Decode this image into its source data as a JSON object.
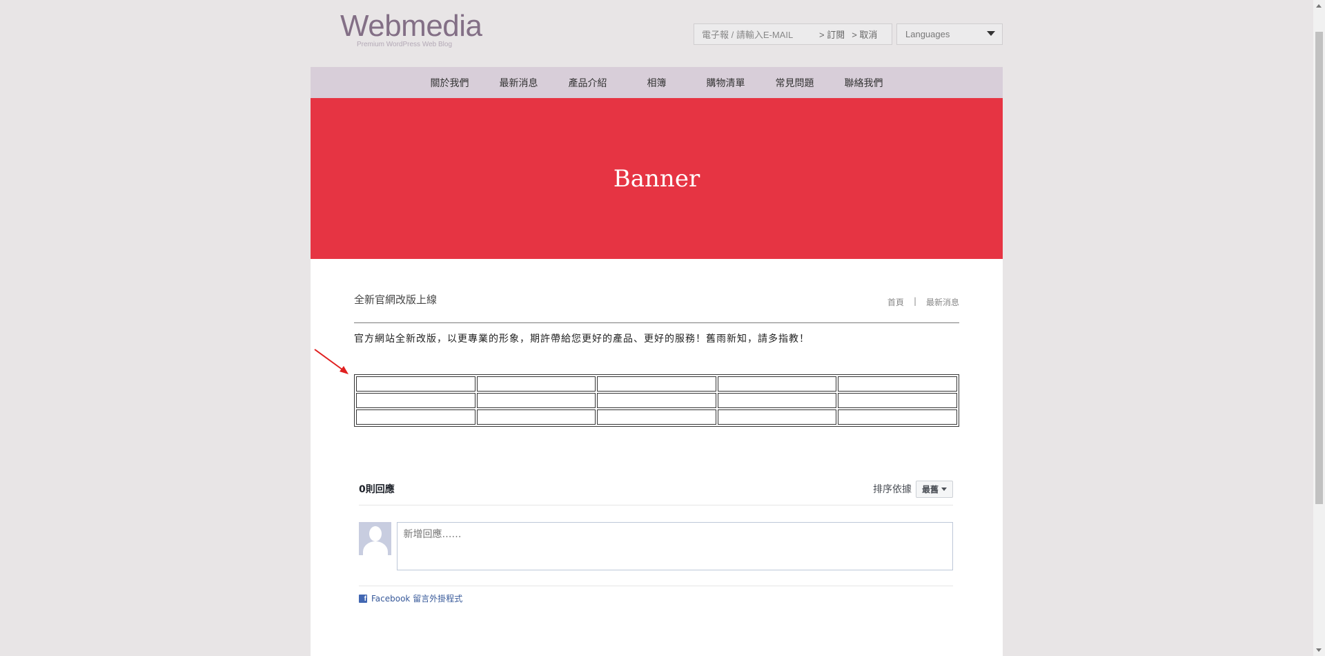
{
  "header": {
    "logo_title": "Webmedia",
    "logo_subtitle": "Premium WordPress Web Blog",
    "newsletter_placeholder": "電子報 / 請輸入E-MAIL",
    "subscribe_label": "> 訂閱",
    "cancel_label": "> 取消",
    "language_label": "Languages"
  },
  "nav": [
    {
      "label": "關於我們"
    },
    {
      "label": "最新消息"
    },
    {
      "label": "產品介紹"
    },
    {
      "label": "相簿"
    },
    {
      "label": "購物清單"
    },
    {
      "label": "常見問題"
    },
    {
      "label": "聯絡我們"
    }
  ],
  "banner": {
    "text": "Banner"
  },
  "post": {
    "title": "全新官網改版上線",
    "breadcrumb": [
      "首頁",
      "|",
      "最新消息"
    ],
    "body": "官方網站全新改版，以更專業的形象，期許帶給您更好的產品、更好的服務！舊雨新知，請多指教！"
  },
  "comments": {
    "count_label": "0則回應",
    "sort_label": "排序依據",
    "sort_value": "最舊",
    "input_placeholder": "新增回應……",
    "plugin_label": "Facebook 留言外掛程式"
  },
  "colors": {
    "banner": "#e63443",
    "nav": "#d8ced9",
    "logo": "#836f86",
    "annotation_arrow": "#e02020"
  }
}
